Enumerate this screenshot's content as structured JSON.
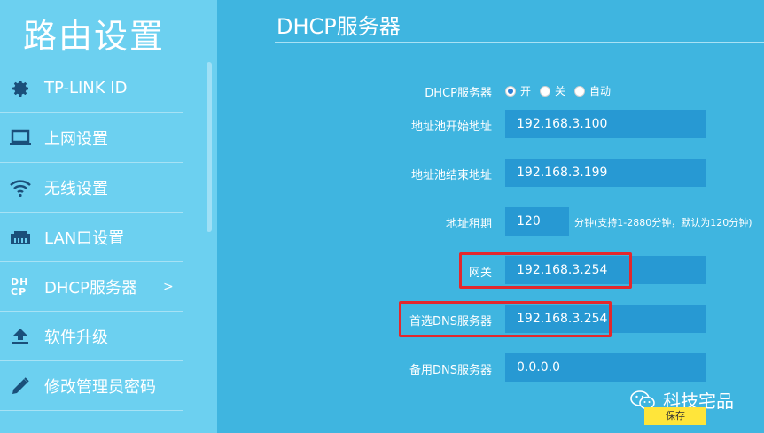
{
  "sidebar": {
    "title": "路由设置",
    "items": [
      {
        "label": "TP-LINK ID",
        "icon": "gear-icon"
      },
      {
        "label": "上网设置",
        "icon": "laptop-icon"
      },
      {
        "label": "无线设置",
        "icon": "wifi-icon"
      },
      {
        "label": "LAN口设置",
        "icon": "lan-port-icon"
      },
      {
        "label": "DHCP服务器",
        "icon": "dhcp-icon",
        "chevron": ">",
        "icon_text": "DH CP"
      },
      {
        "label": "软件升级",
        "icon": "upload-icon"
      },
      {
        "label": "修改管理员密码",
        "icon": "pencil-icon"
      }
    ]
  },
  "main": {
    "title": "DHCP服务器",
    "dhcp": {
      "label": "DHCP服务器",
      "options": [
        "开",
        "关",
        "自动"
      ],
      "selected": "开"
    },
    "pool_start": {
      "label": "地址池开始地址",
      "value": "192.168.3.100"
    },
    "pool_end": {
      "label": "地址池结束地址",
      "value": "192.168.3.199"
    },
    "lease": {
      "label": "地址租期",
      "value": "120",
      "hint": "分钟(支持1-2880分钟，默认为120分钟)"
    },
    "gateway": {
      "label": "网关",
      "value": "192.168.3.254"
    },
    "primary_dns": {
      "label": "首选DNS服务器",
      "value": "192.168.3.254"
    },
    "secondary_dns": {
      "label": "备用DNS服务器",
      "value": "0.0.0.0"
    },
    "save_label": "保存"
  },
  "watermark": {
    "text": "科技宅品"
  },
  "colors": {
    "sidebar_bg": "#6cd0f0",
    "main_bg": "#3fb5e0",
    "input_bg": "#2799d3",
    "highlight": "#e3282d",
    "save_bg": "#ffe53a"
  }
}
